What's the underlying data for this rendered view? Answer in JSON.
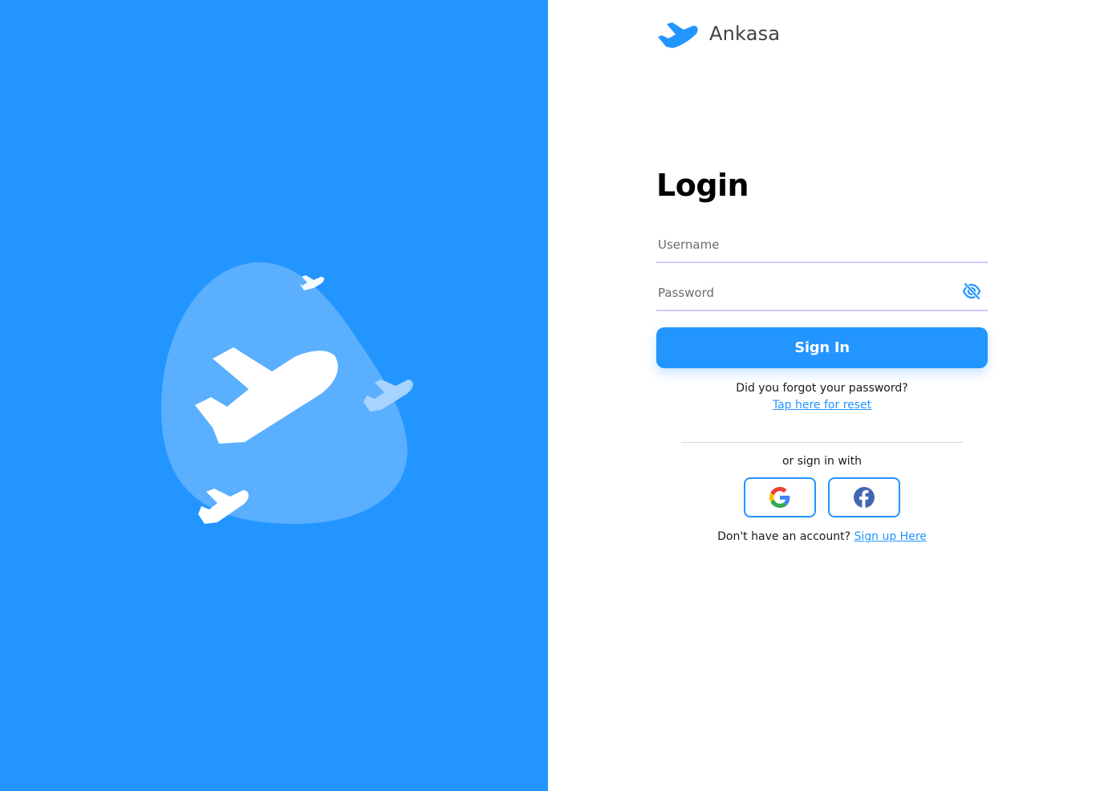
{
  "brand": {
    "name": "Ankasa",
    "logo_icon": "plane-icon"
  },
  "colors": {
    "primary": "#2395ff",
    "blob": "#5aafff",
    "input_underline": "#d2c8ff"
  },
  "login": {
    "title": "Login",
    "username_placeholder": "Username",
    "password_placeholder": "Password",
    "password_toggle_icon": "eye-slash-icon",
    "signin_label": "Sign In",
    "forgot_text": "Did you forgot your password?",
    "reset_link": "Tap here for reset",
    "or_text": "or sign in with",
    "social": [
      {
        "name": "google",
        "icon": "google-icon"
      },
      {
        "name": "facebook",
        "icon": "facebook-icon"
      }
    ],
    "no_account_text": "Don't have an account?",
    "signup_link": "Sign up Here"
  }
}
